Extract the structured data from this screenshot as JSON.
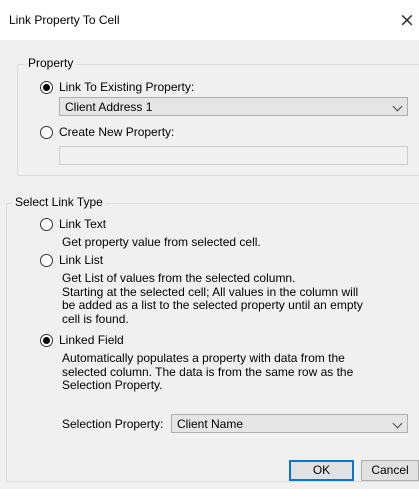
{
  "window": {
    "title": "Link Property To Cell",
    "close_icon": "×"
  },
  "property_group": {
    "label": "Property",
    "link_existing_label": "Link To Existing Property:",
    "existing_property_value": "Client Address 1",
    "create_new_label": "Create New Property:",
    "new_property_value": ""
  },
  "link_type_group": {
    "label": "Select Link Type",
    "link_text_label": "Link Text",
    "link_text_desc": "Get property value from selected cell.",
    "link_list_label": "Link List",
    "link_list_desc": [
      "Get List of values from the selected column.",
      "Starting at the selected cell; All values in the column will",
      "be added as a list to the selected property until an empty",
      "cell is found."
    ],
    "linked_field_label": "Linked Field",
    "linked_field_desc": [
      "Automatically populates a property with data from the",
      "selected column. The data is from the same row as the",
      "Selection Property."
    ],
    "selection_property_label": "Selection Property:",
    "selection_property_value": "Client Name"
  },
  "buttons": {
    "ok_label": "OK",
    "cancel_label": "Cancel"
  }
}
